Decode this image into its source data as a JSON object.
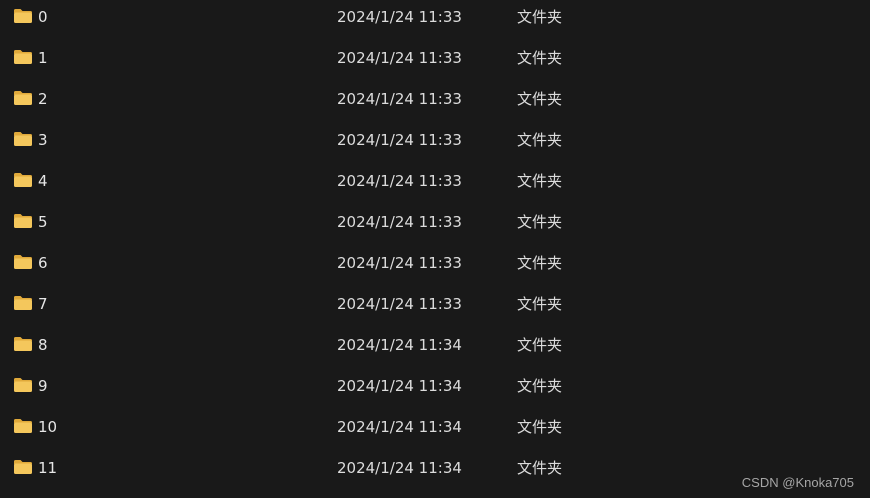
{
  "files": [
    {
      "name": "0",
      "modified": "2024/1/24 11:33",
      "type": "文件夹"
    },
    {
      "name": "1",
      "modified": "2024/1/24 11:33",
      "type": "文件夹"
    },
    {
      "name": "2",
      "modified": "2024/1/24 11:33",
      "type": "文件夹"
    },
    {
      "name": "3",
      "modified": "2024/1/24 11:33",
      "type": "文件夹"
    },
    {
      "name": "4",
      "modified": "2024/1/24 11:33",
      "type": "文件夹"
    },
    {
      "name": "5",
      "modified": "2024/1/24 11:33",
      "type": "文件夹"
    },
    {
      "name": "6",
      "modified": "2024/1/24 11:33",
      "type": "文件夹"
    },
    {
      "name": "7",
      "modified": "2024/1/24 11:33",
      "type": "文件夹"
    },
    {
      "name": "8",
      "modified": "2024/1/24 11:34",
      "type": "文件夹"
    },
    {
      "name": "9",
      "modified": "2024/1/24 11:34",
      "type": "文件夹"
    },
    {
      "name": "10",
      "modified": "2024/1/24 11:34",
      "type": "文件夹"
    },
    {
      "name": "11",
      "modified": "2024/1/24 11:34",
      "type": "文件夹"
    }
  ],
  "icon": "folder-icon",
  "colors": {
    "background": "#191919",
    "text": "#e6e6e6",
    "folder": "#f4c75c",
    "folder_dark": "#e0a93a"
  },
  "watermark": "CSDN @Knoka705"
}
